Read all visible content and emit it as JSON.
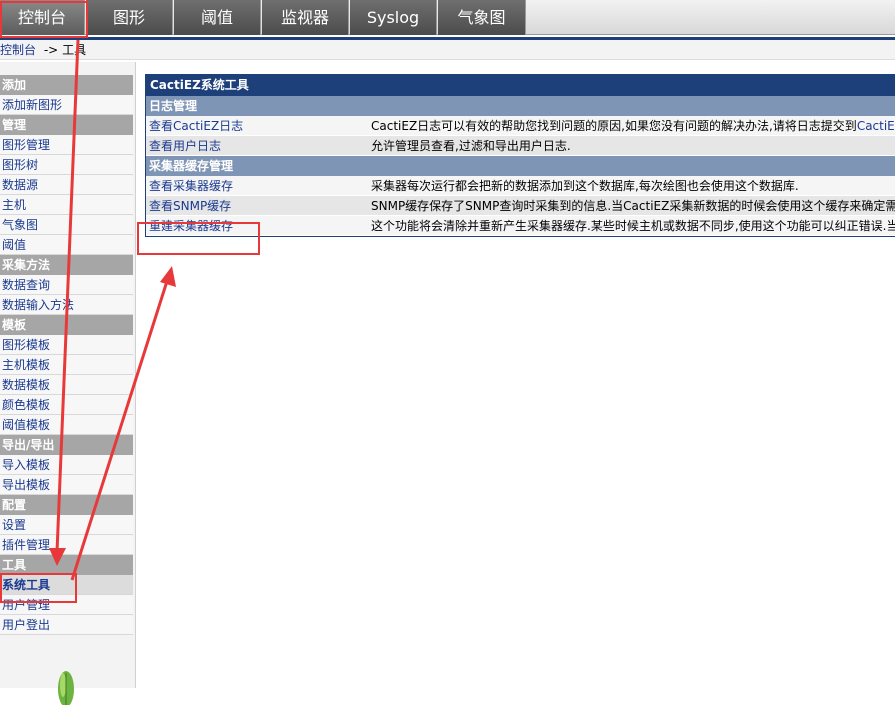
{
  "tabs": [
    {
      "label": "控制台",
      "active": true
    },
    {
      "label": "图形",
      "active": false
    },
    {
      "label": "阈值",
      "active": false
    },
    {
      "label": "监视器",
      "active": false
    },
    {
      "label": "Syslog",
      "active": false
    },
    {
      "label": "气象图",
      "active": false
    }
  ],
  "breadcrumb": {
    "root": "控制台",
    "sep": "->",
    "current": "工具"
  },
  "sidebar": {
    "groups": [
      {
        "header": "添加",
        "items": [
          "添加新图形"
        ]
      },
      {
        "header": "管理",
        "items": [
          "图形管理",
          "图形树",
          "数据源",
          "主机",
          "气象图",
          "阈值"
        ]
      },
      {
        "header": "采集方法",
        "items": [
          "数据查询",
          "数据输入方法"
        ]
      },
      {
        "header": "模板",
        "items": [
          "图形模板",
          "主机模板",
          "数据模板",
          "颜色模板",
          "阈值模板"
        ]
      },
      {
        "header": "导出/导出",
        "items": [
          "导入模板",
          "导出模板"
        ]
      },
      {
        "header": "配置",
        "items": [
          "设置",
          "插件管理"
        ]
      },
      {
        "header": "工具",
        "items": [
          "系统工具",
          "用户管理",
          "用户登出"
        ]
      }
    ],
    "selected": "系统工具"
  },
  "main": {
    "title": "CactiEZ系统工具",
    "sections": [
      {
        "header": "日志管理",
        "rows": [
          {
            "link": "查看CactiEZ日志",
            "desc": "CactiEZ日志可以有效的帮助您找到问题的原因,如果您没有问题的解决办法,请将日志提交到",
            "desc_link": "CactiEZ"
          },
          {
            "link": "查看用户日志",
            "desc": "允许管理员查看,过滤和导出用户日志.",
            "desc_link": ""
          }
        ]
      },
      {
        "header": "采集器缓存管理",
        "rows": [
          {
            "link": "查看采集器缓存",
            "desc": "采集器每次运行都会把新的数据添加到这个数据库,每次绘图也会使用这个数据库.",
            "desc_link": ""
          },
          {
            "link": "查看SNMP缓存",
            "desc": "SNMP缓存保存了SNMP查询时采集到的信息.当CactiEZ采集新数据的时候会使用这个缓存来确定需",
            "desc_link": ""
          },
          {
            "link": "重建采集器缓存",
            "desc": "这个功能将会清除并重新产生采集器缓存.某些时候主机或数据不同步,使用这个功能可以纠正错误.当",
            "desc_link": ""
          }
        ]
      }
    ]
  },
  "colors": {
    "header_blue": "#1d3f7a",
    "section_blue": "#7f95b6",
    "link_blue": "#1a3a8f",
    "annotation_red": "#e8393a"
  }
}
